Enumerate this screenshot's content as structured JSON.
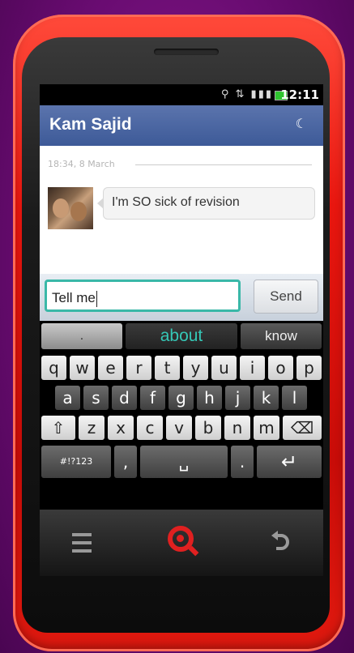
{
  "status_bar": {
    "signal_icons": "⚲ ⇅ ▮▮▮",
    "time": "12:11"
  },
  "header": {
    "contact_name": "Kam Sajid",
    "mode_icon": "☾"
  },
  "conversation": {
    "timestamp": "18:34, 8 March",
    "messages": [
      {
        "text": "I'm SO sick of revision"
      }
    ]
  },
  "compose": {
    "input_value": "Tell me",
    "send_label": "Send"
  },
  "suggestions": [
    ".",
    "about",
    "know"
  ],
  "keyboard": {
    "row1": [
      "q",
      "w",
      "e",
      "r",
      "t",
      "y",
      "u",
      "i",
      "o",
      "p"
    ],
    "row2": [
      "a",
      "s",
      "d",
      "f",
      "g",
      "h",
      "j",
      "k",
      "l"
    ],
    "row3": [
      "⇧",
      "z",
      "x",
      "c",
      "v",
      "b",
      "n",
      "m",
      "⌫"
    ],
    "row4": [
      "#!?123",
      ",",
      "␣",
      ".",
      "↵"
    ]
  },
  "nav": {
    "menu_icon": "menu-icon",
    "search_icon": "search-icon",
    "back_icon": "back-icon"
  },
  "colors": {
    "header": "#3d5a98",
    "accent_teal": "#3ab8a8",
    "phone_red": "#e8160f",
    "background_purple": "#6a0c72"
  }
}
